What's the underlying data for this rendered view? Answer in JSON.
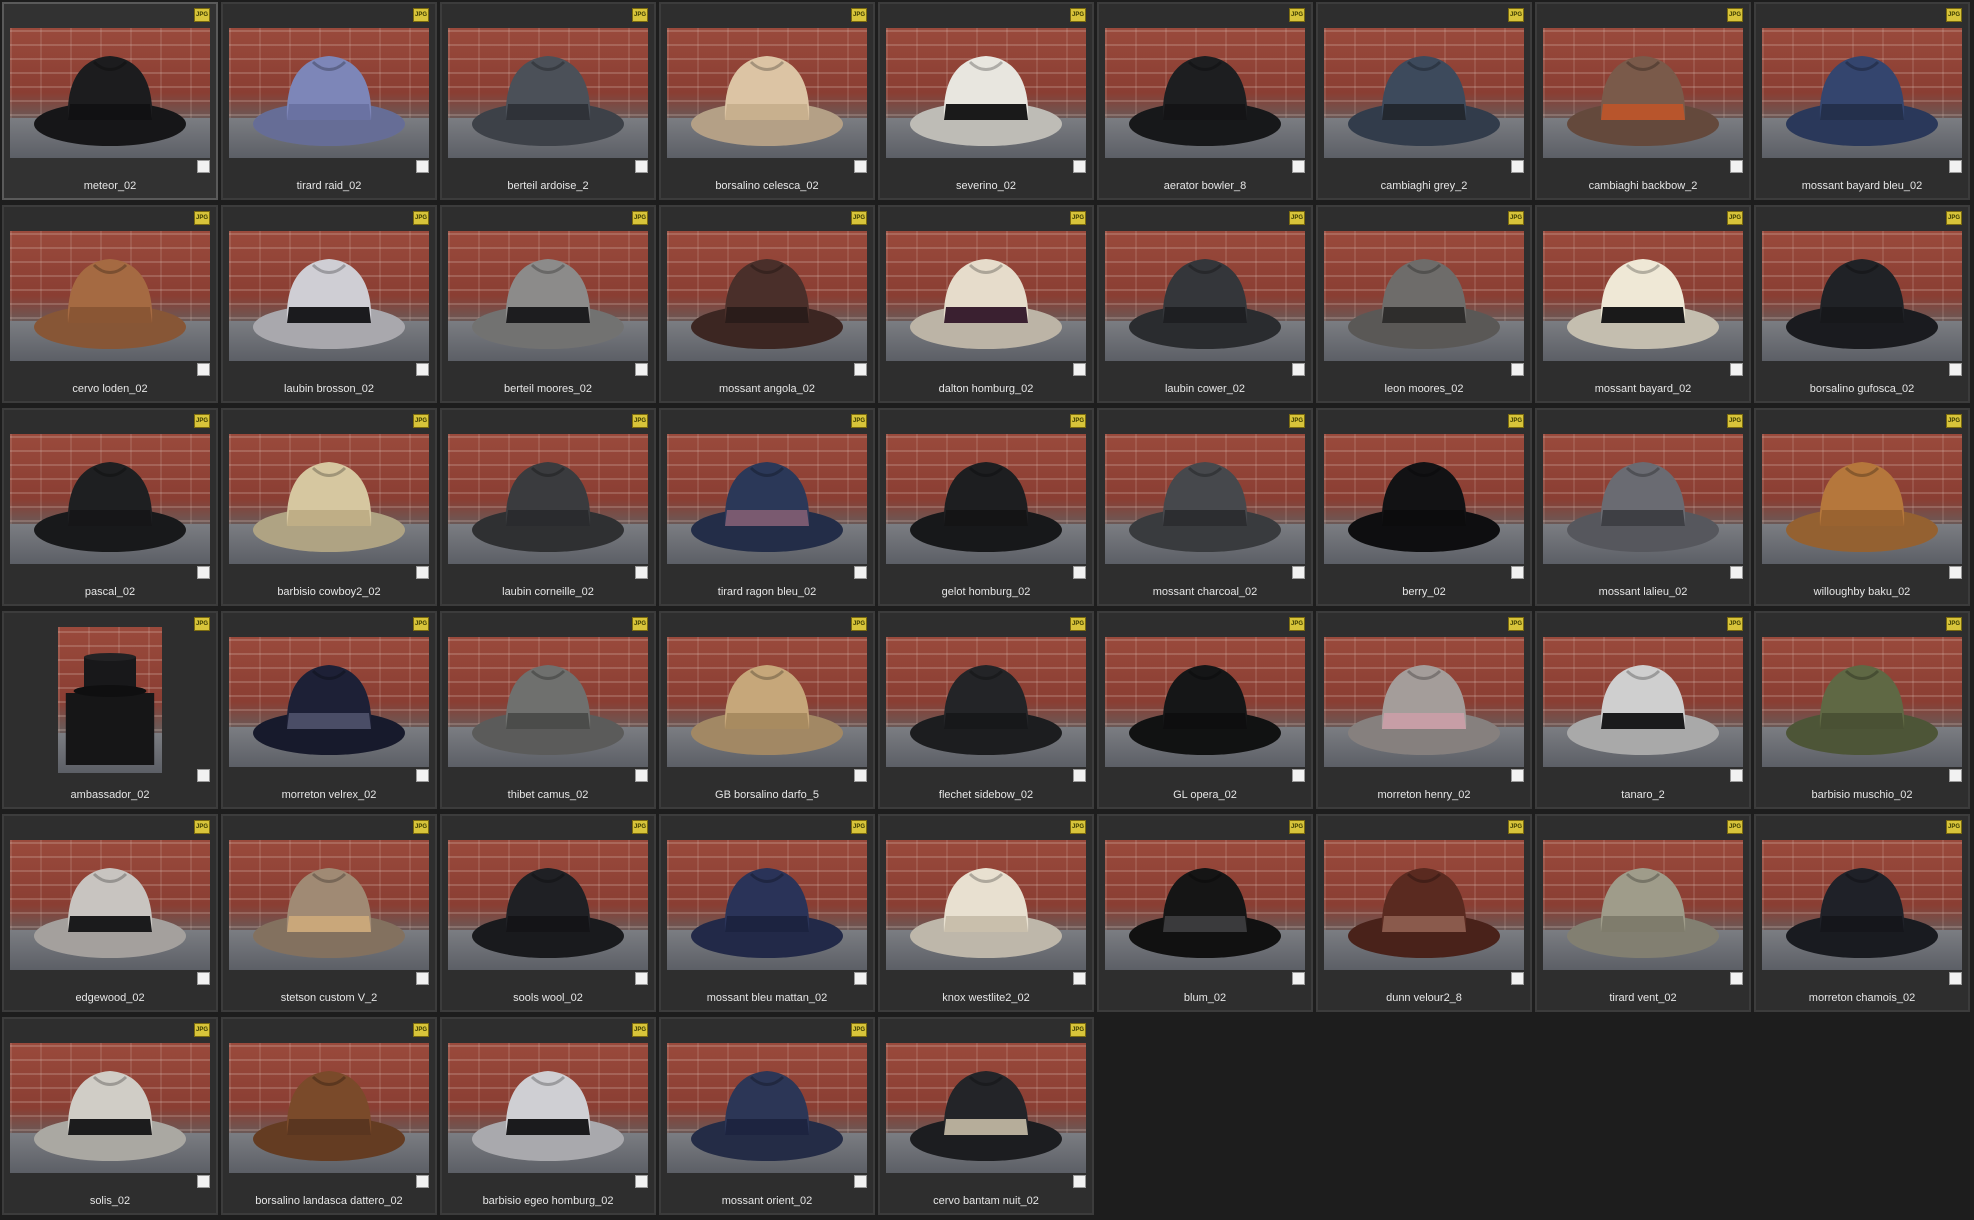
{
  "icons": {
    "file_badge": "jpg-file-icon",
    "select": "checkbox-icon"
  },
  "file_badge_text": "JPG",
  "selected_index": 0,
  "items": [
    {
      "label": "meteor_02",
      "hat": "#1c1c1e",
      "band": "#111113"
    },
    {
      "label": "tirard raid_02",
      "hat": "#7d86b8",
      "band": "#6a72a2"
    },
    {
      "label": "berteil ardoise_2",
      "hat": "#4b5058",
      "band": "#2f3238"
    },
    {
      "label": "borsalino celesca_02",
      "hat": "#dcc4a4",
      "band": "#c8b08e"
    },
    {
      "label": "severino_02",
      "hat": "#e8e6df",
      "band": "#1a1a1a"
    },
    {
      "label": "aerator bowler_8",
      "hat": "#1d1e20",
      "band": "#141416"
    },
    {
      "label": "cambiaghi grey_2",
      "hat": "#3d4a5c",
      "band": "#23282f"
    },
    {
      "label": "cambiaghi backbow_2",
      "hat": "#7a5a4a",
      "band": "#b8552c"
    },
    {
      "label": "mossant bayard bleu_02",
      "hat": "#34456e",
      "band": "#24304c"
    },
    {
      "label": "cervo loden_02",
      "hat": "#a56a42",
      "band": "#8a5634"
    },
    {
      "label": "laubin brosson_02",
      "hat": "#cfced4",
      "band": "#1b1b1e"
    },
    {
      "label": "berteil moores_02",
      "hat": "#8c8b8a",
      "band": "#1d1d1f"
    },
    {
      "label": "mossant angola_02",
      "hat": "#4a2f2a",
      "band": "#2a1c1a"
    },
    {
      "label": "dalton homburg_02",
      "hat": "#e6dccb",
      "band": "#3a2030"
    },
    {
      "label": "laubin cower_02",
      "hat": "#34363a",
      "band": "#1e1f22"
    },
    {
      "label": "leon moores_02",
      "hat": "#6e6c6a",
      "band": "#2e2d2c"
    },
    {
      "label": "mossant bayard_02",
      "hat": "#efe8d6",
      "band": "#1a1a1a"
    },
    {
      "label": "borsalino gufosca_02",
      "hat": "#202226",
      "band": "#17181b"
    },
    {
      "label": "pascal_02",
      "hat": "#1e1f21",
      "band": "#161618"
    },
    {
      "label": "barbisio cowboy2_02",
      "hat": "#d6c7a0",
      "band": "#bfae86"
    },
    {
      "label": "laubin corneille_02",
      "hat": "#3a3b3e",
      "band": "#2a2b2e"
    },
    {
      "label": "tirard ragon bleu_02",
      "hat": "#2b3858",
      "band": "#7a5a70"
    },
    {
      "label": "gelot homburg_02",
      "hat": "#1d1e20",
      "band": "#141415"
    },
    {
      "label": "mossant charcoal_02",
      "hat": "#46484c",
      "band": "#2c2d30"
    },
    {
      "label": "berry_02",
      "hat": "#121214",
      "band": "#0c0c0d"
    },
    {
      "label": "mossant lalieu_02",
      "hat": "#6a6b72",
      "band": "#3e3f44"
    },
    {
      "label": "willoughby baku_02",
      "hat": "#b5773c",
      "band": "#9a6330"
    },
    {
      "label": "ambassador_02",
      "hat": "#18181a",
      "band": "#101011",
      "portrait": true
    },
    {
      "label": "morreton velrex_02",
      "hat": "#1d2036",
      "band": "#4a4d66"
    },
    {
      "label": "thibet camus_02",
      "hat": "#6f706e",
      "band": "#4b4c4a"
    },
    {
      "label": "GB borsalino darfo_5",
      "hat": "#c6a77a",
      "band": "#a88b60"
    },
    {
      "label": "flechet sidebow_02",
      "hat": "#232427",
      "band": "#17181a"
    },
    {
      "label": "GL opera_02",
      "hat": "#151617",
      "band": "#0e0e0f"
    },
    {
      "label": "morreton henry_02",
      "hat": "#a49d9a",
      "band": "#c79ea6"
    },
    {
      "label": "tanaro_2",
      "hat": "#cfcfcf",
      "band": "#1b1b1c"
    },
    {
      "label": "barbisio muschio_02",
      "hat": "#5f6844",
      "band": "#4a5134"
    },
    {
      "label": "edgewood_02",
      "hat": "#c8c4c0",
      "band": "#1b1b1c"
    },
    {
      "label": "stetson custom V_2",
      "hat": "#a08a74",
      "band": "#c9a77a"
    },
    {
      "label": "sools wool_02",
      "hat": "#1f2024",
      "band": "#141417"
    },
    {
      "label": "mossant bleu mattan_02",
      "hat": "#2a3358",
      "band": "#1c2340"
    },
    {
      "label": "knox westlite2_02",
      "hat": "#e8e0d0",
      "band": "#c9bfac"
    },
    {
      "label": "blum_02",
      "hat": "#151515",
      "band": "#3a3a3c"
    },
    {
      "label": "dunn velour2_8",
      "hat": "#5a2a20",
      "band": "#8a5a4c"
    },
    {
      "label": "tirard vent_02",
      "hat": "#9f9c8a",
      "band": "#7f7c6c"
    },
    {
      "label": "morreton chamois_02",
      "hat": "#1f2128",
      "band": "#15161b"
    },
    {
      "label": "solis_02",
      "hat": "#d0cdc6",
      "band": "#1c1c1d"
    },
    {
      "label": "borsalino landasca dattero_02",
      "hat": "#7a4a2a",
      "band": "#5a3620"
    },
    {
      "label": "barbisio egeo homburg_02",
      "hat": "#cfcfd3",
      "band": "#1b1b1d"
    },
    {
      "label": "mossant orient_02",
      "hat": "#2c3656",
      "band": "#1d2440"
    },
    {
      "label": "cervo bantam nuit_02",
      "hat": "#232428",
      "band": "#b6ad9a"
    }
  ]
}
